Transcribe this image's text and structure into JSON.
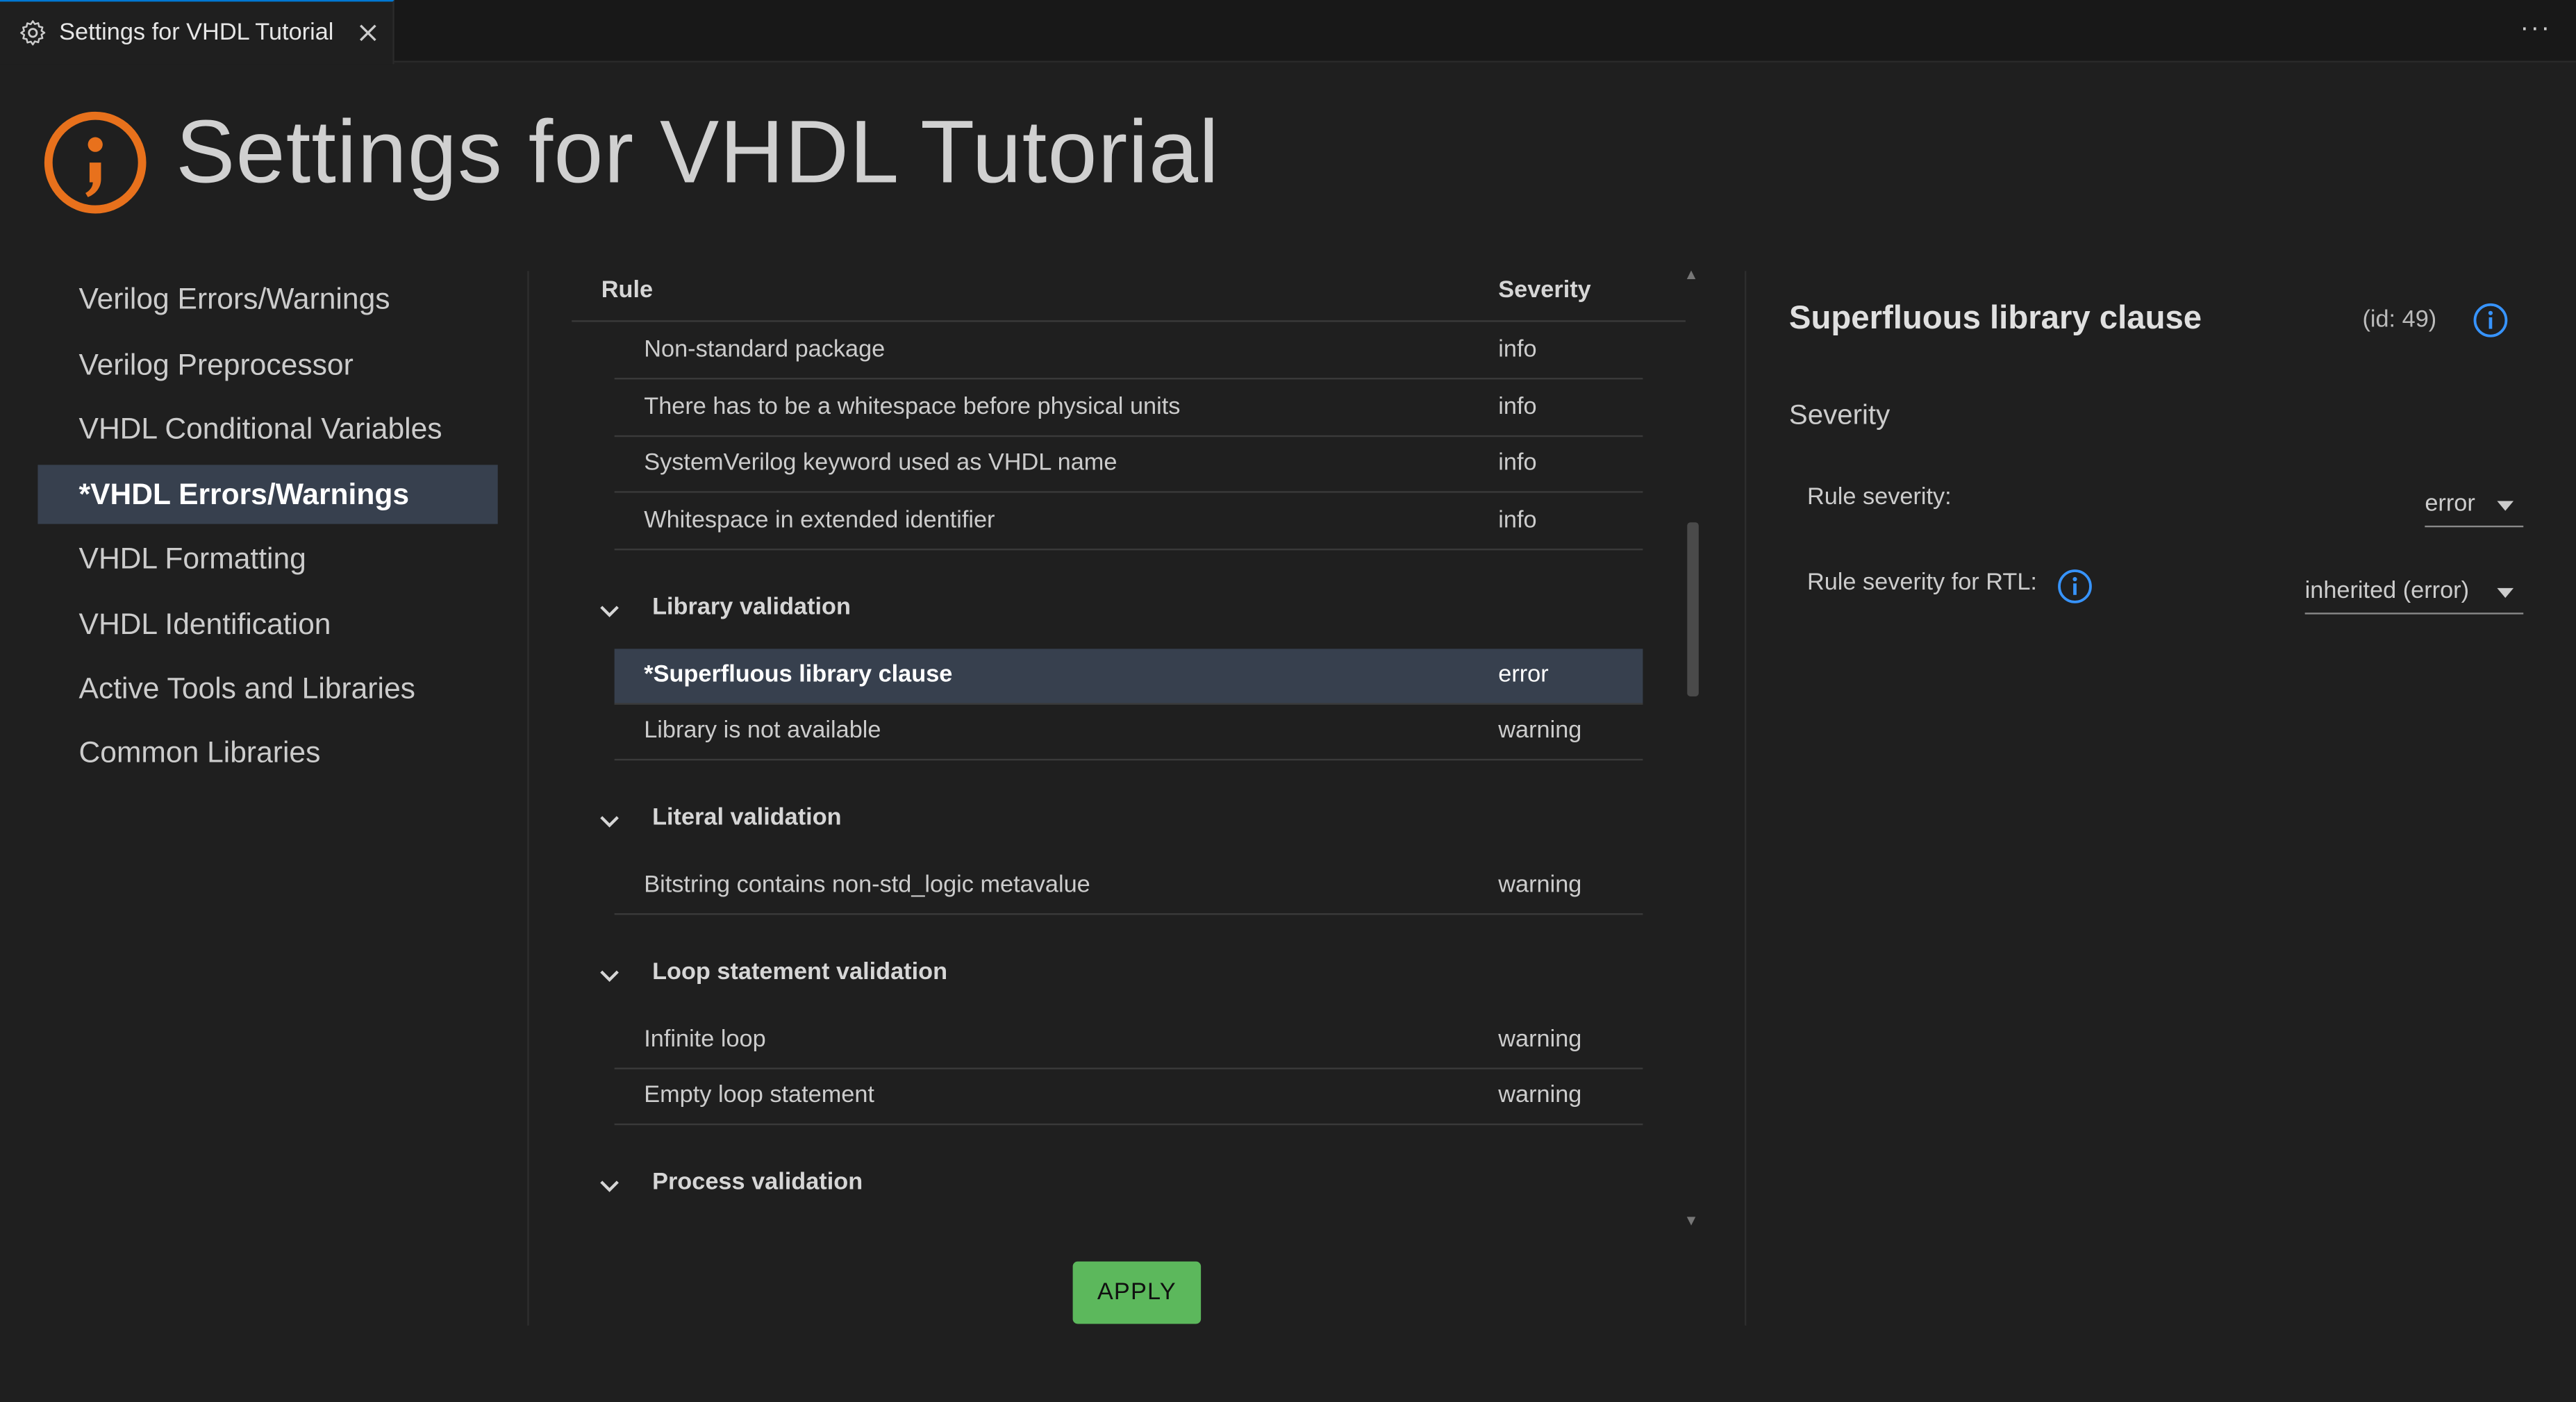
{
  "tab": {
    "label": "Settings for VHDL Tutorial",
    "close": "×"
  },
  "toolbar": {
    "more": "···"
  },
  "header": {
    "title": "Settings for VHDL Tutorial"
  },
  "sidebar": {
    "items": [
      {
        "label": "Verilog Errors/Warnings"
      },
      {
        "label": "Verilog Preprocessor"
      },
      {
        "label": "VHDL Conditional Variables"
      },
      {
        "label": "*VHDL Errors/Warnings"
      },
      {
        "label": "VHDL Formatting"
      },
      {
        "label": "VHDL Identification"
      },
      {
        "label": "Active Tools and Libraries"
      },
      {
        "label": "Common Libraries"
      }
    ],
    "active_index": 3
  },
  "table": {
    "headers": {
      "rule": "Rule",
      "severity": "Severity"
    },
    "rows_top": [
      {
        "rule": "Non-standard package",
        "severity": "info"
      },
      {
        "rule": "There has to be a whitespace before physical units",
        "severity": "info"
      },
      {
        "rule": "SystemVerilog keyword used as VHDL name",
        "severity": "info"
      },
      {
        "rule": "Whitespace in extended identifier",
        "severity": "info"
      }
    ],
    "groups": [
      {
        "label": "Library validation",
        "rows": [
          {
            "rule": "*Superfluous library clause",
            "severity": "error",
            "selected": true
          },
          {
            "rule": "Library is not available",
            "severity": "warning"
          }
        ]
      },
      {
        "label": "Literal validation",
        "rows": [
          {
            "rule": "Bitstring contains non-std_logic metavalue",
            "severity": "warning"
          }
        ]
      },
      {
        "label": "Loop statement validation",
        "rows": [
          {
            "rule": "Infinite loop",
            "severity": "warning"
          },
          {
            "rule": "Empty loop statement",
            "severity": "warning"
          }
        ]
      },
      {
        "label": "Process validation",
        "rows": []
      }
    ]
  },
  "apply": {
    "label": "APPLY"
  },
  "detail": {
    "title": "Superfluous library clause",
    "id": "(id: 49)",
    "section": "Severity",
    "rule_severity_label": "Rule severity:",
    "rule_severity_value": "error",
    "rtl_severity_label": "Rule severity for RTL:",
    "rtl_severity_value": "inherited (error)"
  },
  "colors": {
    "accent": "#0078d4",
    "logo": "#e8711c",
    "info_icon": "#3794ff",
    "selection": "#37404e",
    "apply": "#5cb85c"
  }
}
